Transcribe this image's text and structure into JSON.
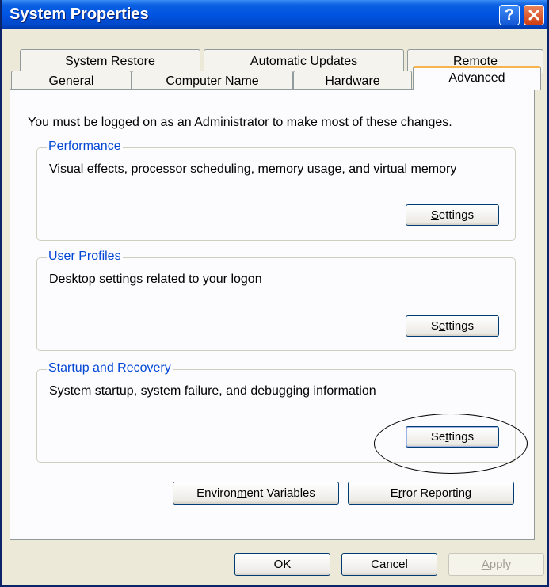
{
  "window": {
    "title": "System Properties"
  },
  "tabs": {
    "back": [
      "System Restore",
      "Automatic Updates",
      "Remote"
    ],
    "front": [
      "General",
      "Computer Name",
      "Hardware",
      "Advanced"
    ],
    "active": "Advanced"
  },
  "intro_text": "You must be logged on as an Administrator to make most of these changes.",
  "groups": {
    "performance": {
      "title": "Performance",
      "description": "Visual effects, processor scheduling, memory usage, and virtual memory",
      "button": {
        "pre": "",
        "mnemonic": "S",
        "post": "ettings"
      }
    },
    "user_profiles": {
      "title": "User Profiles",
      "description": "Desktop settings related to your logon",
      "button": {
        "pre": "S",
        "mnemonic": "e",
        "post": "ttings"
      }
    },
    "startup": {
      "title": "Startup and Recovery",
      "description": "System startup, system failure, and debugging information",
      "button": {
        "pre": "Se",
        "mnemonic": "t",
        "post": "tings"
      }
    }
  },
  "bottom_buttons": {
    "env_vars": {
      "pre": "Environ",
      "mnemonic": "m",
      "post": "ent Variables"
    },
    "error_reporting": {
      "pre": "E",
      "mnemonic": "r",
      "post": "ror Reporting"
    }
  },
  "dialog_buttons": {
    "ok": "OK",
    "cancel": "Cancel",
    "apply": {
      "mnemonic": "A",
      "post": "pply"
    }
  }
}
